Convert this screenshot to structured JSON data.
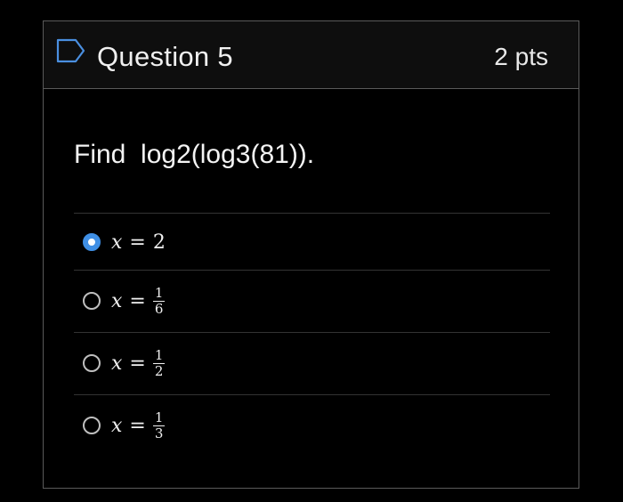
{
  "header": {
    "title": "Question 5",
    "points": "2 pts"
  },
  "question": {
    "text": "Find  log2(log3(81))."
  },
  "answers": [
    {
      "var": "x",
      "op": "=",
      "value": "2",
      "selected": true
    },
    {
      "var": "x",
      "op": "=",
      "numerator": "1",
      "denominator": "6",
      "selected": false
    },
    {
      "var": "x",
      "op": "=",
      "numerator": "1",
      "denominator": "2",
      "selected": false
    },
    {
      "var": "x",
      "op": "=",
      "numerator": "1",
      "denominator": "3",
      "selected": false
    }
  ],
  "colors": {
    "accent": "#3f8fe5",
    "background": "#000000",
    "border": "#5a5a5a"
  },
  "icons": {
    "header": "flag-icon"
  }
}
